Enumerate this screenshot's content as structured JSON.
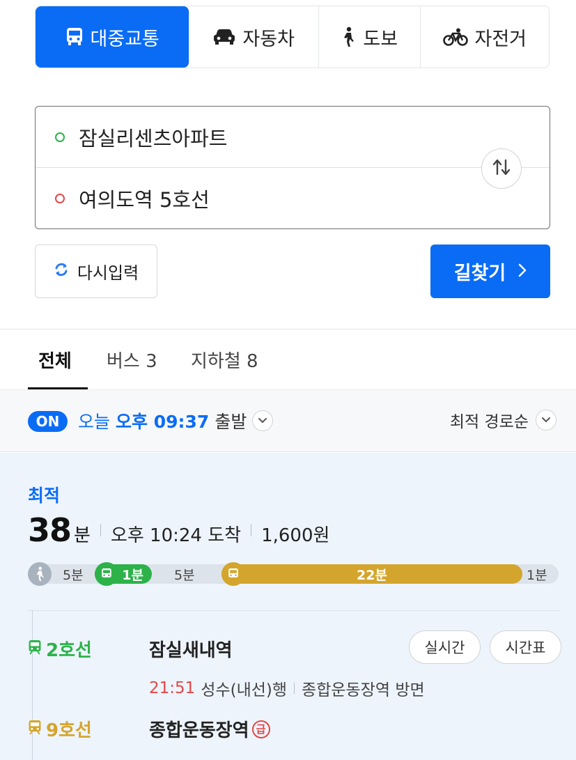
{
  "modes": [
    {
      "label": "대중교통",
      "icon": "bus-icon",
      "active": true
    },
    {
      "label": "자동차",
      "icon": "car-icon",
      "active": false
    },
    {
      "label": "도보",
      "icon": "walk-icon",
      "active": false
    },
    {
      "label": "자전거",
      "icon": "bicycle-icon",
      "active": false
    }
  ],
  "route": {
    "start": "잠실리센츠아파트",
    "end": "여의도역 5호선"
  },
  "buttons": {
    "reset": "다시입력",
    "search": "길찾기"
  },
  "filters": [
    {
      "label": "전체",
      "active": true
    },
    {
      "label": "버스 3",
      "active": false
    },
    {
      "label": "지하철 8",
      "active": false
    }
  ],
  "timebar": {
    "badge": "ON",
    "day": "오늘",
    "time": "오후 09:37",
    "suffix": "출발",
    "sort": "최적 경로순"
  },
  "result": {
    "label": "최적",
    "duration_num": "38",
    "duration_unit": "분",
    "arrival": "오후 10:24 도착",
    "fare": "1,600원",
    "segments": [
      {
        "type": "walk",
        "label": "5분",
        "minutes": 5
      },
      {
        "type": "line2",
        "label": "1분",
        "minutes": 1
      },
      {
        "type": "walk",
        "label": "5분",
        "minutes": 5
      },
      {
        "type": "line9",
        "label": "22분",
        "minutes": 22
      },
      {
        "type": "walk",
        "label": "1분",
        "minutes": 1
      }
    ],
    "steps": [
      {
        "line": "2호선",
        "station": "잠실새내역",
        "realtime": "실시간",
        "timetable": "시간표",
        "depart_time": "21:51",
        "direction": "성수(내선)행",
        "platform": "종합운동장역 방면"
      },
      {
        "line": "9호선",
        "station": "종합운동장역",
        "express": "급"
      }
    ]
  },
  "colors": {
    "primary": "#0a6cf5",
    "line2": "#2db24a",
    "line9": "#d4a52d",
    "walk": "#a9b3bf",
    "start_dot": "#2db24a",
    "end_dot": "#e04848"
  }
}
